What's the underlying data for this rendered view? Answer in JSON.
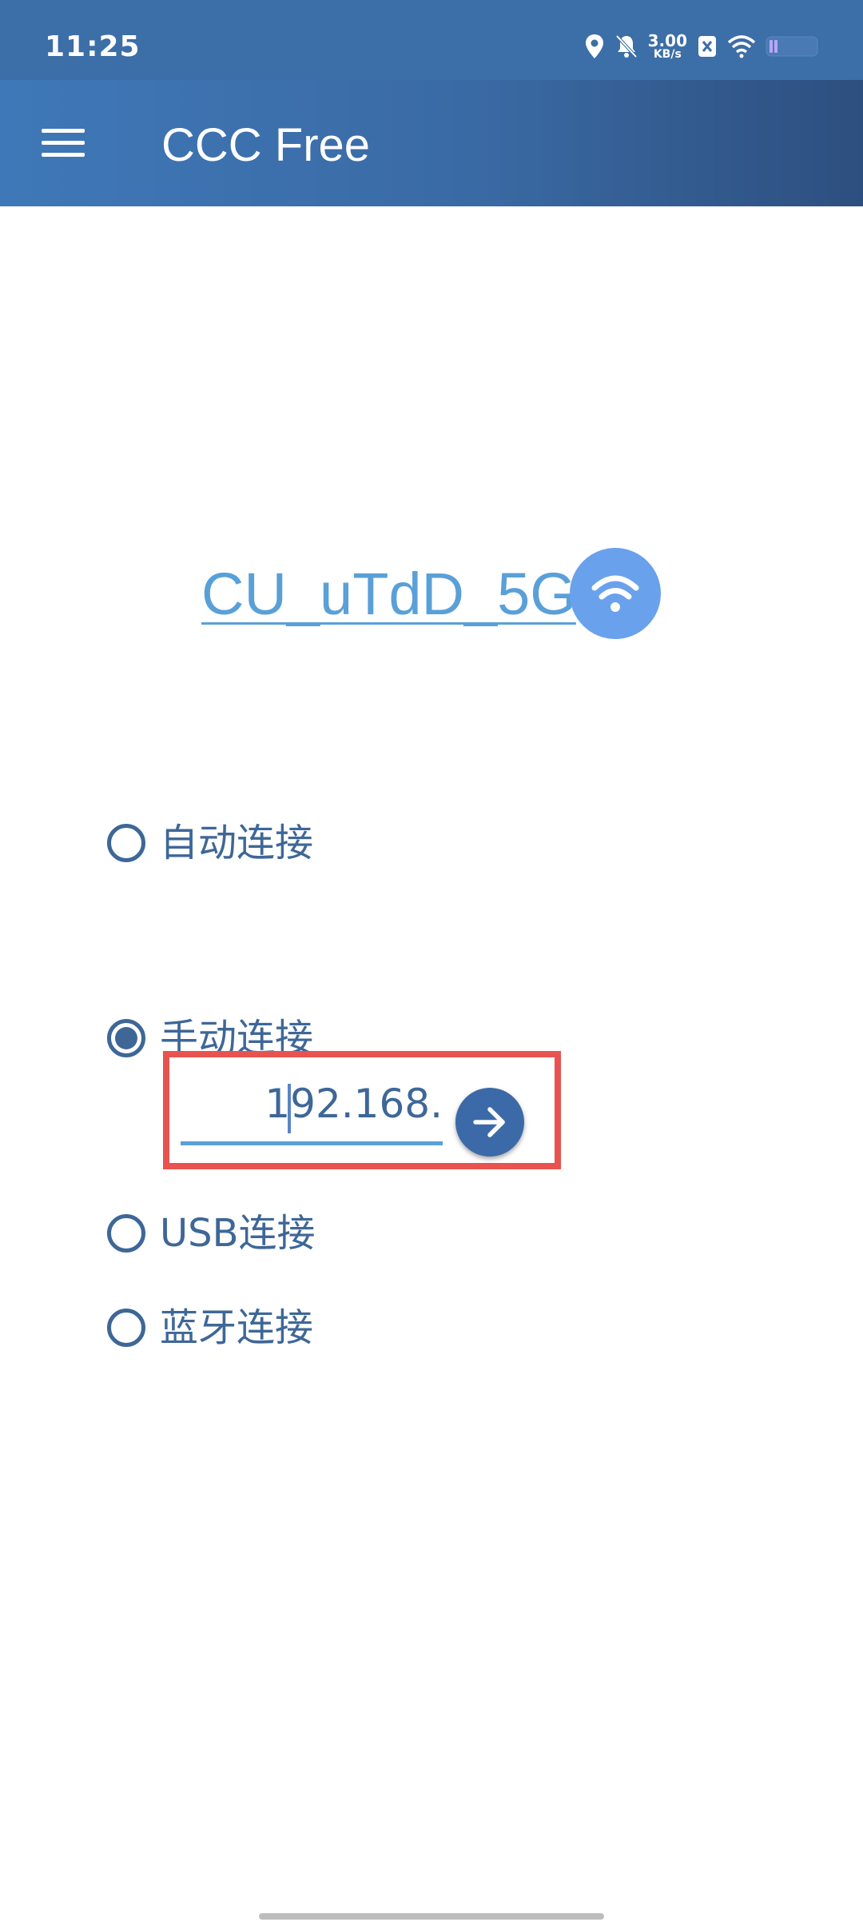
{
  "status_bar": {
    "time": "11:25",
    "net_speed_value": "3.00",
    "net_speed_unit": "KB/s",
    "icons": [
      "location-icon",
      "bell-off-icon",
      "sim-x-icon",
      "wifi-icon",
      "battery-icon"
    ]
  },
  "app_bar": {
    "title": "CCC Free",
    "menu_icon": "menu-icon"
  },
  "network": {
    "name": "CU_uTdD_5G",
    "icon": "wifi-icon",
    "accent": "#6aa1ec"
  },
  "connection_options": [
    {
      "label": "自动连接",
      "selected": false
    },
    {
      "label": "手动连接",
      "selected": true
    },
    {
      "label": "USB连接",
      "selected": false
    },
    {
      "label": "蓝牙连接",
      "selected": false
    }
  ],
  "manual": {
    "ip_value": "192.168.",
    "go_icon": "arrow-right-icon"
  },
  "colors": {
    "primary": "#3e6797",
    "highlight": "#e8534f",
    "link": "#5aa0d8"
  }
}
